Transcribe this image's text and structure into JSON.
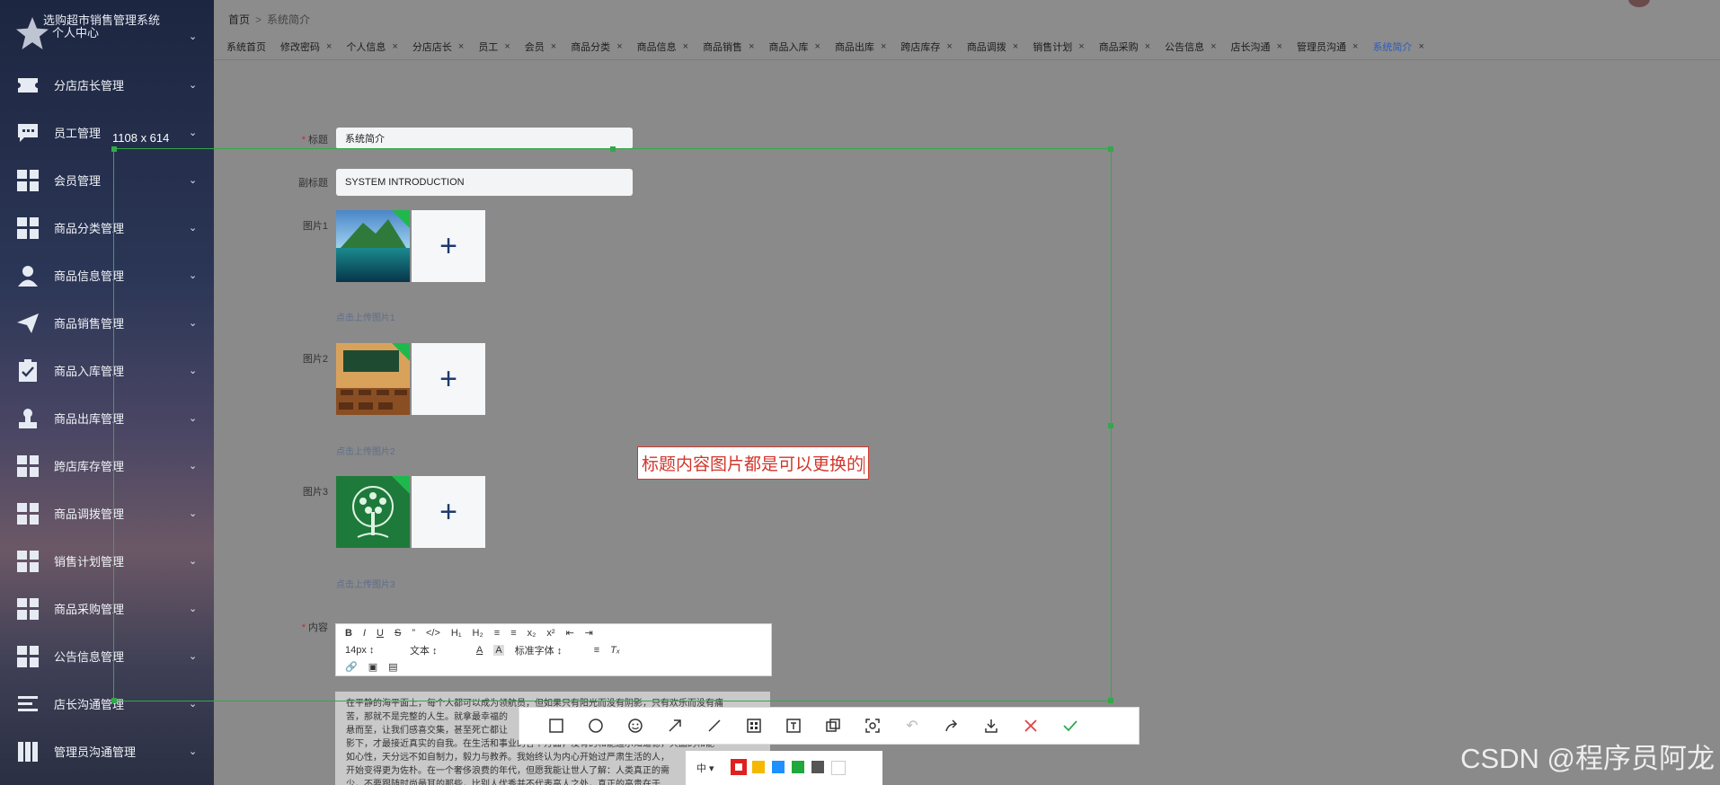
{
  "sidebar": {
    "title": "选购超市销售管理系统",
    "subtitle": "个人中心",
    "items": [
      {
        "label": "分店店长管理",
        "icon": "ticket-icon"
      },
      {
        "label": "员工管理",
        "icon": "chat-icon"
      },
      {
        "label": "会员管理",
        "icon": "grid-icon"
      },
      {
        "label": "商品分类管理",
        "icon": "grid-icon"
      },
      {
        "label": "商品信息管理",
        "icon": "user-icon"
      },
      {
        "label": "商品销售管理",
        "icon": "paper-plane-icon"
      },
      {
        "label": "商品入库管理",
        "icon": "clipboard-check-icon"
      },
      {
        "label": "商品出库管理",
        "icon": "stamp-icon"
      },
      {
        "label": "跨店库存管理",
        "icon": "grid-icon"
      },
      {
        "label": "商品调拨管理",
        "icon": "grid-icon"
      },
      {
        "label": "销售计划管理",
        "icon": "grid-icon"
      },
      {
        "label": "商品采购管理",
        "icon": "grid-icon"
      },
      {
        "label": "公告信息管理",
        "icon": "grid-icon"
      },
      {
        "label": "店长沟通管理",
        "icon": "list-icon"
      },
      {
        "label": "管理员沟通管理",
        "icon": "columns-icon"
      }
    ]
  },
  "breadcrumb": {
    "home": "首页",
    "separator": ">",
    "current": "系统简介"
  },
  "tabs": [
    {
      "label": "系统首页",
      "closable": false
    },
    {
      "label": "修改密码",
      "closable": true
    },
    {
      "label": "个人信息",
      "closable": true
    },
    {
      "label": "分店店长",
      "closable": true
    },
    {
      "label": "员工",
      "closable": true
    },
    {
      "label": "会员",
      "closable": true
    },
    {
      "label": "商品分类",
      "closable": true
    },
    {
      "label": "商品信息",
      "closable": true
    },
    {
      "label": "商品销售",
      "closable": true
    },
    {
      "label": "商品入库",
      "closable": true
    },
    {
      "label": "商品出库",
      "closable": true
    },
    {
      "label": "跨店库存",
      "closable": true
    },
    {
      "label": "商品调拨",
      "closable": true
    },
    {
      "label": "销售计划",
      "closable": true
    },
    {
      "label": "商品采购",
      "closable": true
    },
    {
      "label": "公告信息",
      "closable": true
    },
    {
      "label": "店长沟通",
      "closable": true
    },
    {
      "label": "管理员沟通",
      "closable": true
    },
    {
      "label": "系统简介",
      "closable": true,
      "active": true
    }
  ],
  "form": {
    "title_label": "标题",
    "title_value": "系统简介",
    "subtitle_label": "副标题",
    "subtitle_value": "SYSTEM INTRODUCTION",
    "image1_label": "图片1",
    "image1_hint": "点击上传图片1",
    "image2_label": "图片2",
    "image2_hint": "点击上传图片2",
    "image3_label": "图片3",
    "image3_hint": "点击上传图片3",
    "content_label": "内容",
    "plus": "+"
  },
  "editor": {
    "font_size": "14px",
    "para": "文本",
    "font": "标准字体",
    "body_lines": [
      "在平静的海平面上，每个人都可以成为领航员，但如果只有阳光而没有阴影，只有欢乐而没有痛",
      "苦，那就不是完整的人生。就拿最幸福的",
      "悬而至，让我们感喜交集，甚至死亡都让",
      "影下，才最接近真实的自我。在生活和事业的各个方面，没有的和能迫示知道德，天品的和能",
      "如心性，天分远不如自制力，毅力与教养。我始终认为内心开始过严肃生活的人，",
      "开始变得更为佐朴。在一个奢侈浪费的年代，但愿我能让世人了解：人类真正的需",
      "少，不要跟随时尚最耳的那些，比别人优秀并不代表高人之处，真正的高贵在于"
    ]
  },
  "screenshot_tool": {
    "size_label": "1108 x 614",
    "annotation_text": "标题内容图片都是可以更换的",
    "size_option": "中",
    "colors": [
      "#e02020",
      "#f5b800",
      "#1e90ff",
      "#1fa83c",
      "#555555",
      "#ffffff"
    ]
  },
  "watermark": "CSDN @程序员阿龙"
}
